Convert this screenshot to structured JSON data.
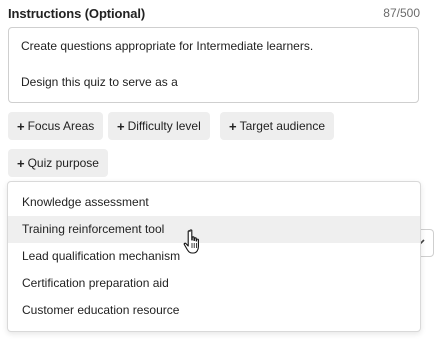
{
  "instructions": {
    "label": "Instructions (Optional)",
    "char_count": "87/500",
    "text_lines": [
      "Create questions appropriate for Intermediate learners.",
      "Design this quiz to serve as a"
    ]
  },
  "chips": [
    {
      "plus": "+",
      "label": "Focus Areas"
    },
    {
      "plus": "+",
      "label": "Difficulty level"
    },
    {
      "plus": "+",
      "label": "Target audience"
    },
    {
      "plus": "+",
      "label": "Quiz purpose"
    }
  ],
  "dropdown": {
    "options": [
      "Knowledge assessment",
      "Training reinforcement tool",
      "Lead qualification mechanism",
      "Certification preparation aid",
      "Customer education resource"
    ],
    "hovered_index": 1
  },
  "icons": {
    "chevron": "chevron-down-icon",
    "cursor": "hand-pointer-icon"
  }
}
